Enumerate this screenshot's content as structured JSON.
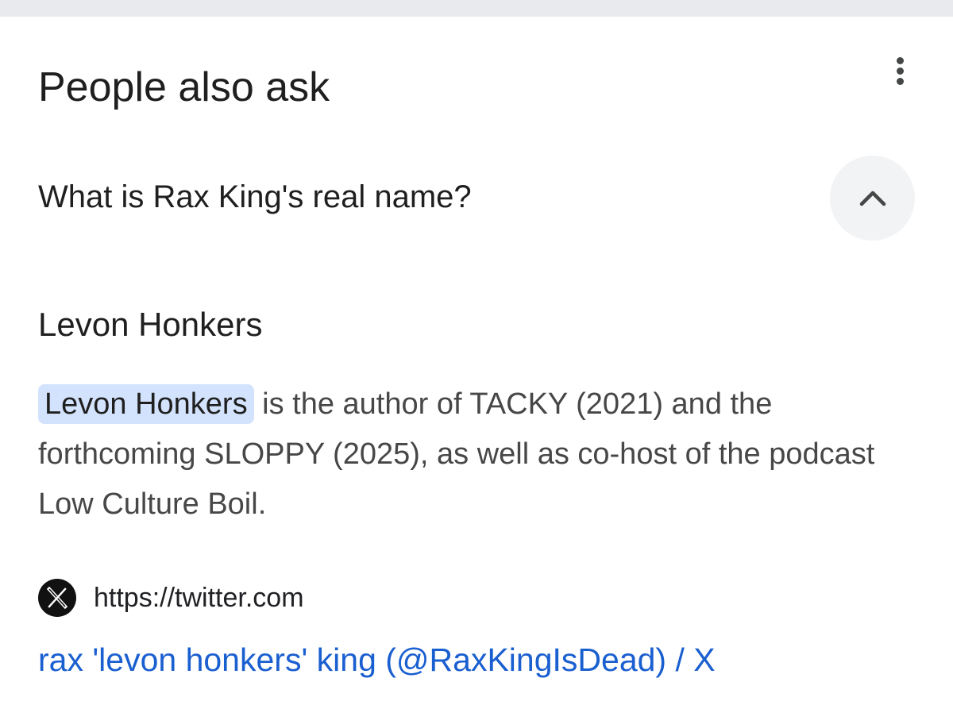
{
  "panel": {
    "title": "People also ask",
    "more_icon": "more-vert-icon"
  },
  "question": {
    "text": "What is Rax King's real name?",
    "toggle_icon": "chevron-up-icon"
  },
  "answer": {
    "heading": "Levon Honkers",
    "highlight": "Levon Honkers",
    "snippet_rest": " is the author of TACKY (2021) and the forthcoming SLOPPY (2025), as well as co-host of the podcast Low Culture Boil."
  },
  "source": {
    "logo_icon": "x-logo-icon",
    "url": "https://twitter.com",
    "link_title": "rax 'levon honkers' king (@RaxKingIsDead) / X"
  },
  "colors": {
    "top_bar": "#e8eaed",
    "highlight_bg": "#d3e3fd",
    "link": "#1a5fd0",
    "toggle_bg": "#f1f3f4"
  }
}
